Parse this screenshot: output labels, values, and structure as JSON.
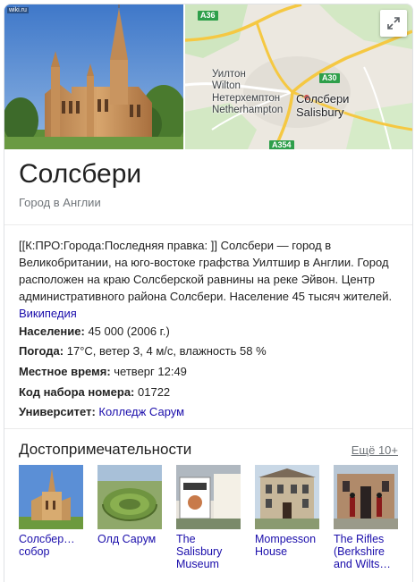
{
  "photo": {
    "badge": "wiki.ru"
  },
  "map": {
    "labels": {
      "wilton_ru": "Уилтон",
      "wilton_en": "Wilton",
      "netherhampton_ru": "Нетерхемптон",
      "netherhampton_en": "Netherhampton",
      "salisbury_ru": "Солсбери",
      "salisbury_en": "Salisbury"
    },
    "roads": [
      "A36",
      "A30",
      "A354"
    ],
    "expand_icon": "expand-icon"
  },
  "entity": {
    "title": "Солсбери",
    "subtitle": "Город в Англии"
  },
  "description": {
    "text": "[[К:ПРО:Города:Последняя правка: ]] Солсбери — город в Великобритании, на юго-востоке графства Уилтшир в Англии. Город расположен на краю Солсберской равнины на реке Эйвон. Центр административного района Солсбери. Население 45 тысяч жителей.",
    "source_link": "Википедия"
  },
  "facts": [
    {
      "label": "Население:",
      "value": "45 000 (2006 г.)"
    },
    {
      "label": "Погода:",
      "value": "17°C, ветер З, 4 м/с, влажность 58 %"
    },
    {
      "label": "Местное время:",
      "value": "четверг 12:49"
    },
    {
      "label": "Код набора номера:",
      "value": "01722"
    },
    {
      "label": "Университет:",
      "value": "Колледж Сарум"
    }
  ],
  "attractions": {
    "title": "Достопримечательности",
    "more": "Ещё 10+",
    "items": [
      {
        "label": "Солсбер… собор"
      },
      {
        "label": "Олд Сарум"
      },
      {
        "label": "The Salisbury Museum"
      },
      {
        "label": "Mompesson House"
      },
      {
        "label": "The Rifles (Berkshire and Wilts…"
      }
    ]
  }
}
